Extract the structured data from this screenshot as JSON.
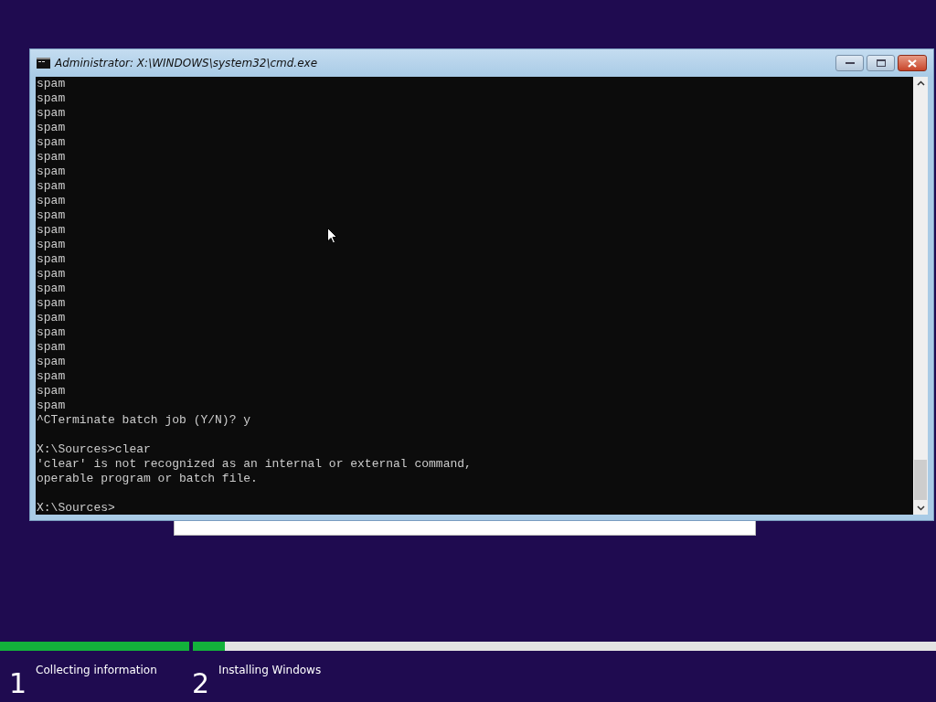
{
  "window": {
    "title": "Administrator: X:\\WINDOWS\\system32\\cmd.exe"
  },
  "console": {
    "blocks": [
      {
        "lines": [
          "spam",
          "spam",
          "spam",
          "spam",
          "spam",
          "spam",
          "spam",
          "spam",
          "spam",
          "spam",
          "spam",
          "spam",
          "spam",
          "spam",
          "spam",
          "spam",
          "spam",
          "spam",
          "spam",
          "spam",
          "spam",
          "spam",
          "spam",
          "^CTerminate batch job (Y/N)? y"
        ]
      },
      {
        "lines": [
          "X:\\Sources>clear",
          "'clear' is not recognized as an internal or external command,",
          "operable program or batch file."
        ]
      },
      {
        "lines": [
          "X:\\Sources>"
        ]
      }
    ]
  },
  "progress": [
    {
      "number": "1",
      "label": "Collecting information",
      "level": 1
    },
    {
      "number": "2",
      "label": "Installing Windows",
      "level": 0.043
    }
  ]
}
